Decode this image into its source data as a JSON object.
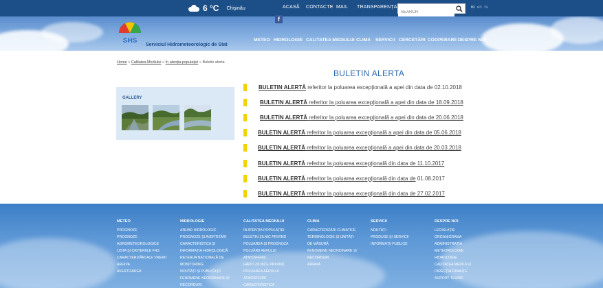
{
  "topbar": {
    "temperature": "6 °C",
    "city": "Chişinău",
    "nav": [
      "ACASĂ",
      "CONTACTE",
      "MAIL",
      "TRANSPARENȚA"
    ],
    "search_placeholder": "SEARCH",
    "languages": [
      "ro",
      "en",
      "ru"
    ]
  },
  "header": {
    "org_name": "Serviciul Hidrometeorologic de Stat",
    "logo_text": "SHS",
    "social": "f",
    "mainnav": [
      "METEO",
      "HIDROLOGIE",
      "CALITATEA MEDIULUI",
      "CLIMA",
      "SERVICII",
      "CERCETĂRI",
      "COOPERARE",
      "DESPRE NOI"
    ]
  },
  "breadcrumb": {
    "home": "Home",
    "sep1": " » ",
    "b1": "Calitatea Mediului",
    "sep2": " » ",
    "b2": "În atenția populației",
    "sep3": " » ",
    "current": "Buletin alerta"
  },
  "gallery": {
    "title": "GALLERY"
  },
  "page_title": "BULETIN ALERTA",
  "alerts": [
    {
      "bold": " BULETIN ALERTĂ",
      "text": " referitor la poluarea excepțională a apei din data de 02.10.2018"
    },
    {
      "bold": " BULETIN ALERTĂ",
      "text": " referitor la poluarea excepțională a apei din data de 18.09.2018"
    },
    {
      "bold": "BULETIN ALERTĂ",
      "text": " referitor la poluarea excepțională a apei din data de 20.06.2018"
    },
    {
      "bold": "BULETIN ALERTĂ",
      "text": " referitor la poluarea excepțională a apei din data de 05.06.2018"
    },
    {
      "bold": "BULETIN ALERTĂ",
      "text": " referitor la poluarea excepțională a apei din data de 20.03.2018"
    },
    {
      "bold": "BULETIN  ALERTĂ",
      "text": " referitor la poluarea excepțională din data de 11.10.2017"
    },
    {
      "bold": "BULETIN ALERTĂ",
      "text": " referitor la poluarea excepțională din data de",
      "tail": " 01.08.2017"
    },
    {
      "bold": "BULETIN ALERTĂ",
      "text": " referitor la poluarea excepțională din data de 27.02.2017"
    }
  ],
  "footer": {
    "columns": [
      {
        "title": "METEO",
        "items": [
          "PROGNOZE",
          "PROGNOZE",
          "AGROMETEOROLOGICE",
          "LISTA ȘI CRITERIILE FHS",
          "CARACTERIZĂRI ALE VREMII",
          "ARHIVA",
          "AVERTIZAREA"
        ]
      },
      {
        "title": "HIDROLOGIE",
        "items": [
          "ANUAR HIDROLOGIC",
          "PROGNOZE ȘI AVERTIZĂRI",
          "CARACTERISTICA ȘI",
          "INFORMAȚIA HIDROLOGICĂ",
          "REȚEAUA NAȚIONALĂ DE",
          "MONITORING",
          "NOUTĂȚI ȘI PUBLICAȚII",
          "FENOMENE NEORDINARE ȘI",
          "RECORDURI"
        ]
      },
      {
        "title": "CALITATEA MEDIULUI",
        "items": [
          "ÎN ATENȚIA POPULAȚIEI",
          "BULETIN ZILNIC PRIVIND",
          "POLUAREA ȘI PROGNOZA",
          "POLUĂRII AERULUI",
          "ATMOSFERIC",
          "HĂRȚI ZILNICE PRIVIND",
          "POLUAREA AERULUI",
          "ATMOSFERIC",
          "CARACTERISTICA"
        ]
      },
      {
        "title": "CLIMA",
        "items": [
          "CARACTERIZĂRI CLIMATICE",
          "TERMINOLOGIE ȘI UNITĂȚI",
          "DE MĂSURĂ",
          "FENOMENE NEORDINARE ȘI",
          "RECORDURI",
          "ARHIVA"
        ]
      },
      {
        "title": "SERVICII",
        "items": [
          "NOUTĂȚI",
          "PRODUSE ȘI SERVICII",
          "INFORMAȚII PUBLICE"
        ]
      },
      {
        "title": "DESPRE NOI",
        "items": [
          "LEGISLAȚIE",
          "ORGANIGRAMA",
          "ADMINISTRAȚIA",
          "METEOROLOGIE",
          "HIDROLOGIE",
          "CALITATEA MEDIULUI",
          "DIRECȚIA FINANȚE",
          "SUPORT TEHNIC"
        ]
      }
    ]
  }
}
